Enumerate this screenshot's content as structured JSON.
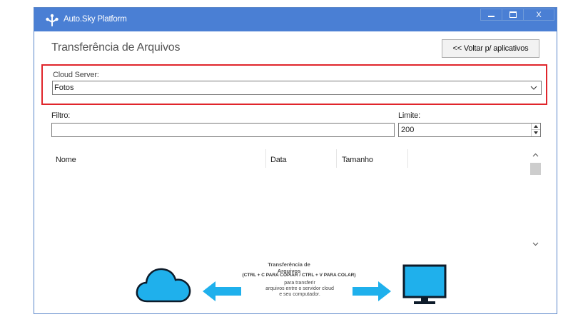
{
  "window": {
    "title": "Auto.Sky Platform",
    "controls": {
      "minimize": "",
      "maximize": "",
      "close": "X"
    }
  },
  "page": {
    "title": "Transferência de Arquivos",
    "back_button": "<< Voltar p/ aplicativos"
  },
  "cloud_server": {
    "label": "Cloud Server:",
    "selected": "Fotos"
  },
  "filter": {
    "label": "Filtro:",
    "value": "",
    "placeholder": ""
  },
  "limit": {
    "label": "Limite:",
    "value": "200"
  },
  "file_list": {
    "columns": [
      "Nome",
      "Data",
      "Tamanho"
    ],
    "rows": []
  },
  "banner": {
    "title": "Transferência de Arquivos",
    "shortcuts": "(CTRL + C PARA COPIAR / CTRL + V PARA COLAR)",
    "description_lines": [
      "para transferir",
      "arquivos entre o servidor cloud",
      "e seu computador."
    ]
  },
  "colors": {
    "titlebar": "#4a7fd4",
    "highlight_border": "#e0252b",
    "illustration_blue": "#1fb0ec"
  }
}
